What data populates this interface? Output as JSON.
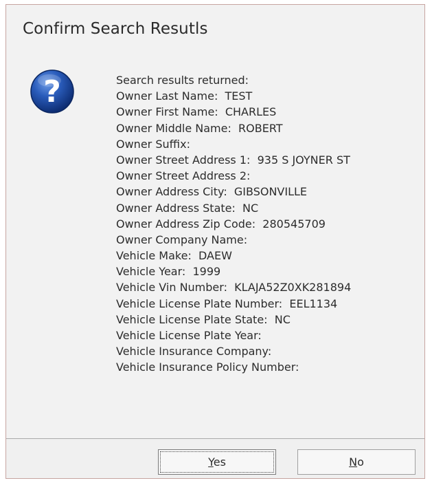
{
  "dialog": {
    "title": "Confirm Search Resutls",
    "icon": "question-icon",
    "message_lines": [
      "Search results returned:",
      "Owner Last Name:  TEST",
      "Owner First Name:  CHARLES",
      "Owner Middle Name:  ROBERT",
      "Owner Suffix:",
      "Owner Street Address 1:  935 S JOYNER ST",
      "Owner Street Address 2:",
      "Owner Address City:  GIBSONVILLE",
      "Owner Address State:  NC",
      "Owner Address Zip Code:  280545709",
      "Owner Company Name:",
      "Vehicle Make:  DAEW",
      "Vehicle Year:  1999",
      "Vehicle Vin Number:  KLAJA52Z0XK281894",
      "Vehicle License Plate Number:  EEL1134",
      "Vehicle License Plate State:  NC",
      "Vehicle License Plate Year:",
      "Vehicle Insurance Company:",
      "Vehicle Insurance Policy Number:"
    ],
    "buttons": {
      "yes": {
        "mnemonic": "Y",
        "rest": "es"
      },
      "no": {
        "mnemonic": "N",
        "rest": "o"
      }
    },
    "colors": {
      "icon_blue": "#1f4fa6",
      "background": "#f2f2f2",
      "border": "#c6a4a0"
    }
  }
}
